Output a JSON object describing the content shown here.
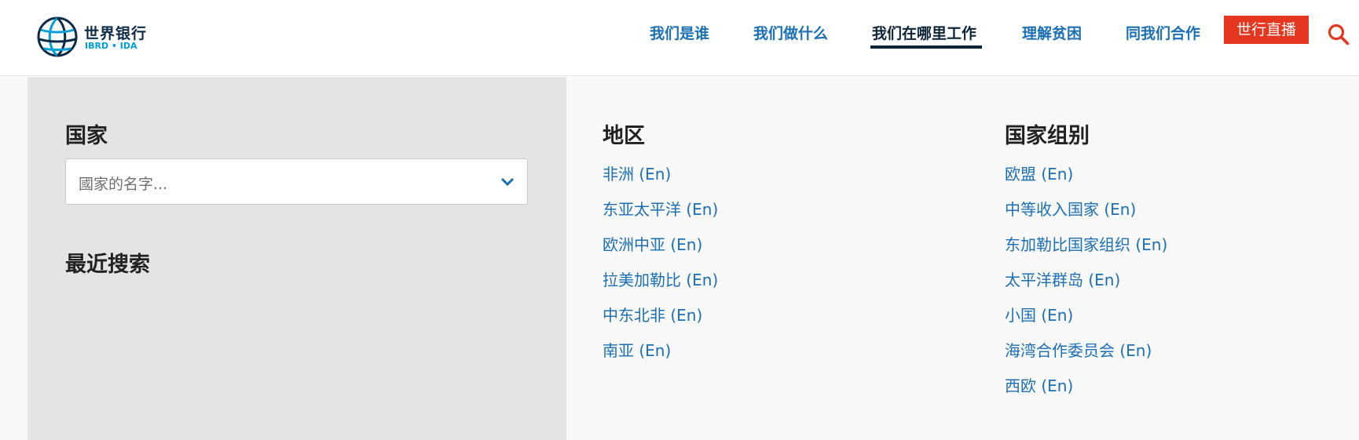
{
  "header": {
    "logo": {
      "name_cn": "世界银行",
      "name_en": "IBRD • IDA",
      "icon": "globe-icon"
    },
    "nav": [
      {
        "label": "我们是谁",
        "active": false
      },
      {
        "label": "我们做什么",
        "active": false
      },
      {
        "label": "我们在哪里工作",
        "active": true
      },
      {
        "label": "理解贫困",
        "active": false
      },
      {
        "label": "同我们合作",
        "active": false
      }
    ],
    "live_button": "世行直播",
    "search_icon": "search-icon"
  },
  "countries": {
    "title": "国家",
    "select": {
      "placeholder": "國家的名字...",
      "icon": "chevron-down-icon"
    },
    "recent_title": "最近搜索"
  },
  "regions": {
    "title": "地区",
    "items": [
      {
        "label": "非洲 (En)"
      },
      {
        "label": "东亚太平洋 (En)"
      },
      {
        "label": "欧洲中亚 (En)"
      },
      {
        "label": "拉美加勒比 (En)"
      },
      {
        "label": "中东北非 (En)"
      },
      {
        "label": "南亚 (En)"
      }
    ]
  },
  "country_groups": {
    "title": "国家组别",
    "items": [
      {
        "label": "欧盟 (En)"
      },
      {
        "label": "中等收入国家 (En)"
      },
      {
        "label": "东加勒比国家组织 (En)"
      },
      {
        "label": "太平洋群岛 (En)"
      },
      {
        "label": "小国 (En)"
      },
      {
        "label": "海湾合作委员会 (En)"
      },
      {
        "label": "西欧 (En)"
      }
    ]
  },
  "colors": {
    "link": "#1b6fb5",
    "active_nav": "#0d2338",
    "live_button_bg": "#e5361f",
    "search_icon": "#e5361f",
    "left_panel_bg": "#e4e4e4",
    "right_panel_bg": "#f8f8f8"
  }
}
